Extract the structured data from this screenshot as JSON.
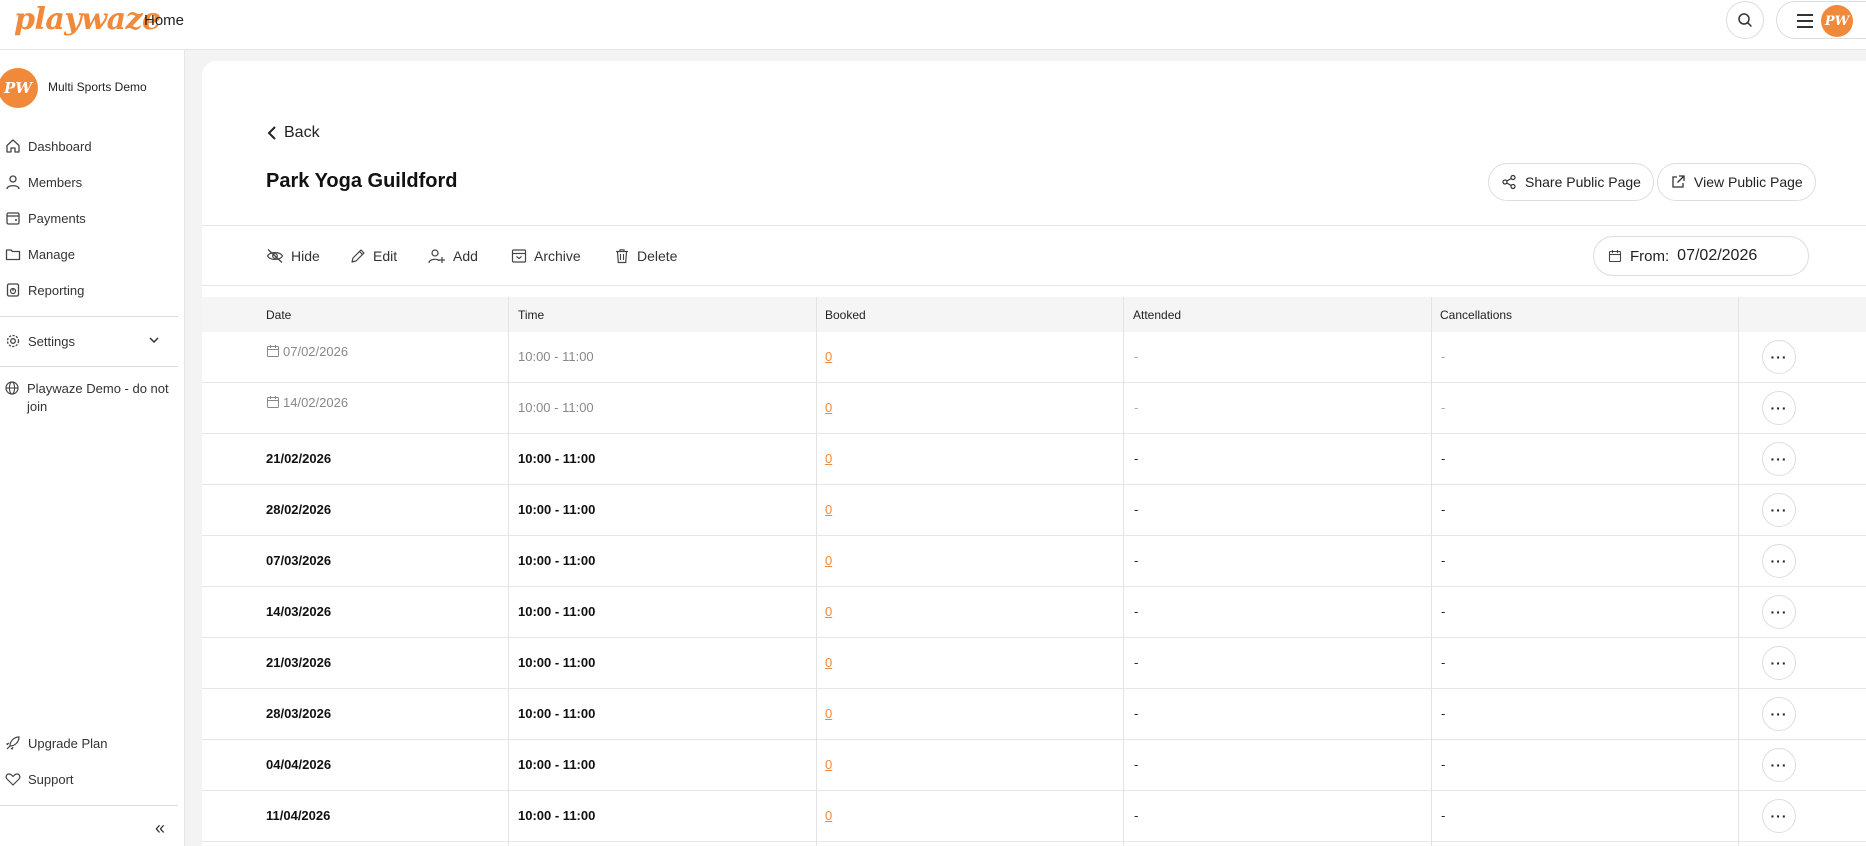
{
  "topbar": {
    "logo": "playwaze",
    "home_label": "Home",
    "avatar_initials": "PW"
  },
  "sidebar": {
    "org_avatar": "PW",
    "org_name": "Multi Sports Demo",
    "items": [
      {
        "label": "Dashboard",
        "icon": "home-icon"
      },
      {
        "label": "Members",
        "icon": "user-icon"
      },
      {
        "label": "Payments",
        "icon": "wallet-icon"
      },
      {
        "label": "Manage",
        "icon": "folder-icon"
      },
      {
        "label": "Reporting",
        "icon": "report-icon"
      }
    ],
    "settings_label": "Settings",
    "community_label": "Playwaze Demo - do not join",
    "upgrade_label": "Upgrade Plan",
    "support_label": "Support",
    "collapse_glyph": "«"
  },
  "page": {
    "back_label": "Back",
    "title": "Park Yoga Guildford",
    "share_label": "Share Public Page",
    "view_label": "View Public Page"
  },
  "actions": {
    "hide": "Hide",
    "edit": "Edit",
    "add": "Add",
    "archive": "Archive",
    "delete": "Delete",
    "from_label": "From:",
    "from_value": "07/02/2026"
  },
  "table": {
    "headers": [
      "Date",
      "Time",
      "Booked",
      "Attended",
      "Cancellations"
    ],
    "rows": [
      {
        "date": "07/02/2026",
        "time": "10:00 - 11:00",
        "booked": "0",
        "attended": "-",
        "cancellations": "-",
        "past": true
      },
      {
        "date": "14/02/2026",
        "time": "10:00 - 11:00",
        "booked": "0",
        "attended": "-",
        "cancellations": "-",
        "past": true
      },
      {
        "date": "21/02/2026",
        "time": "10:00 - 11:00",
        "booked": "0",
        "attended": "-",
        "cancellations": "-",
        "past": false
      },
      {
        "date": "28/02/2026",
        "time": "10:00 - 11:00",
        "booked": "0",
        "attended": "-",
        "cancellations": "-",
        "past": false
      },
      {
        "date": "07/03/2026",
        "time": "10:00 - 11:00",
        "booked": "0",
        "attended": "-",
        "cancellations": "-",
        "past": false
      },
      {
        "date": "14/03/2026",
        "time": "10:00 - 11:00",
        "booked": "0",
        "attended": "-",
        "cancellations": "-",
        "past": false
      },
      {
        "date": "21/03/2026",
        "time": "10:00 - 11:00",
        "booked": "0",
        "attended": "-",
        "cancellations": "-",
        "past": false
      },
      {
        "date": "28/03/2026",
        "time": "10:00 - 11:00",
        "booked": "0",
        "attended": "-",
        "cancellations": "-",
        "past": false
      },
      {
        "date": "04/04/2026",
        "time": "10:00 - 11:00",
        "booked": "0",
        "attended": "-",
        "cancellations": "-",
        "past": false
      },
      {
        "date": "11/04/2026",
        "time": "10:00 - 11:00",
        "booked": "0",
        "attended": "-",
        "cancellations": "-",
        "past": false
      }
    ],
    "more_glyph": "···"
  },
  "colors": {
    "accent": "#f0893a",
    "border": "#dddddd",
    "background": "#f3f3f3"
  }
}
